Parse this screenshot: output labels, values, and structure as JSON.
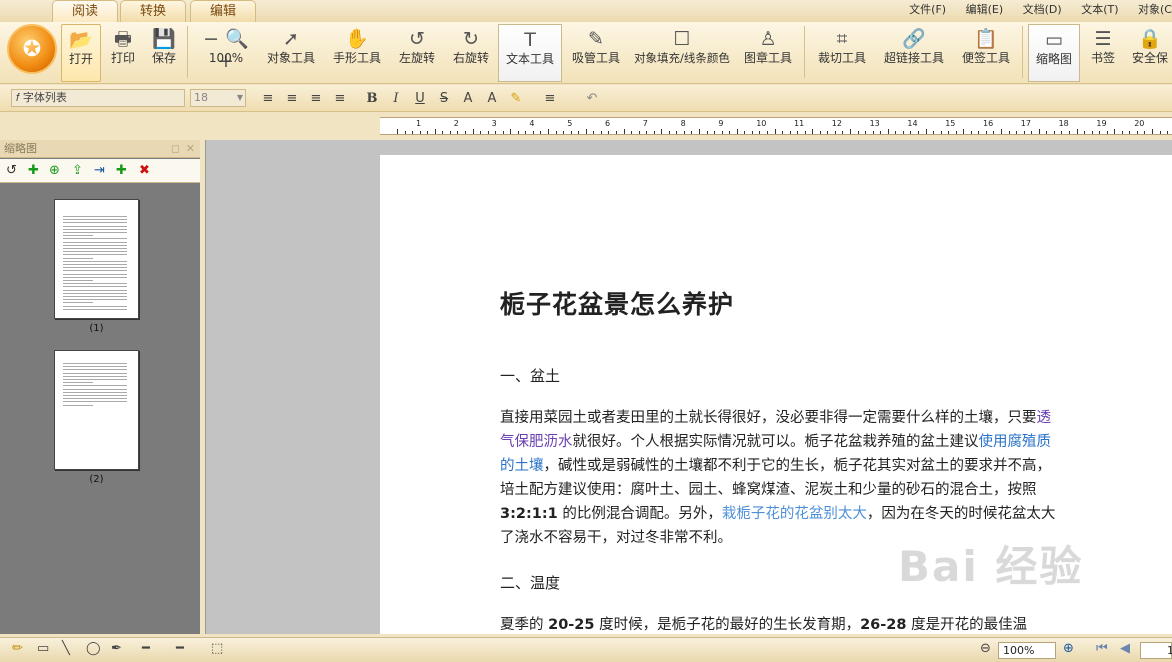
{
  "tabs": [
    "阅读",
    "转换",
    "编辑"
  ],
  "menu": [
    "文件(F)",
    "编辑(E)",
    "文档(D)",
    "文本(T)",
    "对象(C"
  ],
  "logo_glyph": "✪",
  "toolbar": [
    {
      "label": "打开",
      "icon": "folder-icon",
      "glyph": "📂"
    },
    {
      "label": "打印",
      "icon": "printer-icon",
      "glyph": "🖶"
    },
    {
      "label": "保存",
      "icon": "save-icon",
      "glyph": "💾"
    },
    {
      "label": "100%",
      "icon": "zoom-icon",
      "glyph": "🔍"
    },
    {
      "label": "对象工具",
      "icon": "cursor-icon",
      "glyph": "➚"
    },
    {
      "label": "手形工具",
      "icon": "hand-icon",
      "glyph": "✋"
    },
    {
      "label": "左旋转",
      "icon": "rotate-left-icon",
      "glyph": "↺"
    },
    {
      "label": "右旋转",
      "icon": "rotate-right-icon",
      "glyph": "↻"
    },
    {
      "label": "文本工具",
      "icon": "text-icon",
      "glyph": "T"
    },
    {
      "label": "吸管工具",
      "icon": "eyedropper-icon",
      "glyph": "✎"
    },
    {
      "label": "对象填充/线条颜色",
      "icon": "fill-color-icon",
      "glyph": "☐"
    },
    {
      "label": "图章工具",
      "icon": "stamp-icon",
      "glyph": "♙"
    },
    {
      "label": "裁切工具",
      "icon": "crop-icon",
      "glyph": "⌗"
    },
    {
      "label": "超链接工具",
      "icon": "link-icon",
      "glyph": "🔗"
    },
    {
      "label": "便签工具",
      "icon": "note-icon",
      "glyph": "📋"
    },
    {
      "label": "缩略图",
      "icon": "thumbnail-icon",
      "glyph": "▭"
    },
    {
      "label": "书签",
      "icon": "bookmark-icon",
      "glyph": "☰"
    },
    {
      "label": "安全保",
      "icon": "lock-icon",
      "glyph": "🔒"
    }
  ],
  "zoom_minus": "−",
  "zoom_plus": "+",
  "format": {
    "font_placeholder": "字体列表",
    "font_icon": "𝑓",
    "size_value": "18",
    "buttons": [
      "≡",
      "≡",
      "≡",
      "≡",
      "B",
      "I",
      "U",
      "S",
      "A",
      "A",
      "✎",
      "≡",
      "↶"
    ]
  },
  "ruler_numbers": [
    "1",
    "2",
    "3",
    "4",
    "5",
    "6",
    "7",
    "8",
    "9",
    "10",
    "11",
    "12",
    "13",
    "14",
    "15",
    "16",
    "17",
    "18",
    "19",
    "20"
  ],
  "sidebar": {
    "title": "缩略图",
    "tool_glyphs": [
      "↺",
      "✚",
      "⊕",
      "⇪",
      "⇥",
      "✚",
      "✖"
    ],
    "pages": [
      "(1)",
      "(2)"
    ]
  },
  "document": {
    "title": "栀子花盆景怎么养护",
    "section1": "一、盆土",
    "p1": [
      {
        "t": "直接用菜园土或者麦田里的土就长得很好，没必要非得一定需要什么样的土壤，只要",
        "c": ""
      },
      {
        "t": "透气保肥沥水",
        "c": "hl-purple"
      },
      {
        "t": "就很好。个人根据实际情况就可以。栀子花盆栽养殖的盆土建议",
        "c": ""
      },
      {
        "t": "使用腐殖质的土壤",
        "c": "hl-blue"
      },
      {
        "t": "，碱性或是弱碱性的土壤都不利于它的生长，栀子花其实对盆土的要求并不高，培土配方建议使用：腐叶土、园土、蜂窝煤渣、泥炭土和少量的砂石的混合土，按照 ",
        "c": ""
      },
      {
        "t": "3:2:1:1",
        "c": "bold"
      },
      {
        "t": " 的比例混合调配。另外，",
        "c": ""
      },
      {
        "t": "栽栀子花的花盆别太大",
        "c": "hl-lblue"
      },
      {
        "t": "，因为在冬天的时候花盆太大了浇水不容易干，对过冬非常不利。",
        "c": ""
      }
    ],
    "section2": "二、温度",
    "p2": [
      {
        "t": "夏季的 ",
        "c": ""
      },
      {
        "t": "20-25",
        "c": "bold"
      },
      {
        "t": " 度时候，是栀子花的最好的生长发育期，",
        "c": ""
      },
      {
        "t": "26-28",
        "c": "bold"
      },
      {
        "t": " 度是开花的最佳温",
        "c": ""
      }
    ],
    "watermark": "Bai 经验"
  },
  "status": {
    "tool_glyphs": [
      "✏",
      "▭",
      "╲",
      "◯",
      "✒",
      "━",
      "━",
      "⬚"
    ],
    "zoom_value": "100%",
    "page_value": "1",
    "nav_glyphs": [
      "⊖",
      "⊕",
      "⏮",
      "◀"
    ]
  }
}
